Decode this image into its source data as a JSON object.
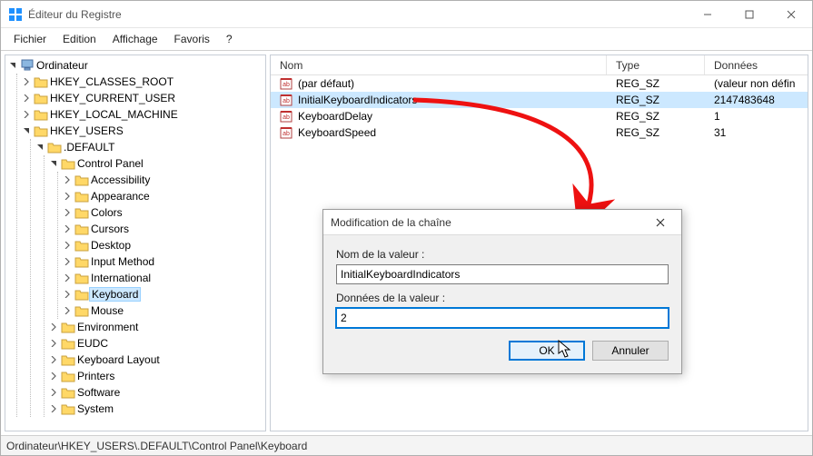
{
  "window": {
    "title": "Éditeur du Registre"
  },
  "menu": {
    "items": [
      "Fichier",
      "Edition",
      "Affichage",
      "Favoris",
      "?"
    ]
  },
  "tree": {
    "root": "Ordinateur",
    "hives": [
      "HKEY_CLASSES_ROOT",
      "HKEY_CURRENT_USER",
      "HKEY_LOCAL_MACHINE",
      "HKEY_USERS"
    ],
    "default_key": ".DEFAULT",
    "control_panel": "Control Panel",
    "cp_items": [
      "Accessibility",
      "Appearance",
      "Colors",
      "Cursors",
      "Desktop",
      "Input Method",
      "International",
      "Keyboard",
      "Mouse"
    ],
    "after_cp": [
      "Environment",
      "EUDC",
      "Keyboard Layout",
      "Printers",
      "Software",
      "System"
    ],
    "selected": "Keyboard"
  },
  "list": {
    "headers": {
      "name": "Nom",
      "type": "Type",
      "data": "Données"
    },
    "rows": [
      {
        "name": "(par défaut)",
        "type": "REG_SZ",
        "data": "(valeur non défin",
        "selected": false
      },
      {
        "name": "InitialKeyboardIndicators",
        "type": "REG_SZ",
        "data": "2147483648",
        "selected": true
      },
      {
        "name": "KeyboardDelay",
        "type": "REG_SZ",
        "data": "1",
        "selected": false
      },
      {
        "name": "KeyboardSpeed",
        "type": "REG_SZ",
        "data": "31",
        "selected": false
      }
    ]
  },
  "dialog": {
    "title": "Modification de la chaîne",
    "name_label": "Nom de la valeur :",
    "name_value": "InitialKeyboardIndicators",
    "data_label": "Données de la valeur :",
    "data_value": "2",
    "ok": "OK",
    "cancel": "Annuler"
  },
  "statusbar": {
    "path": "Ordinateur\\HKEY_USERS\\.DEFAULT\\Control Panel\\Keyboard"
  }
}
